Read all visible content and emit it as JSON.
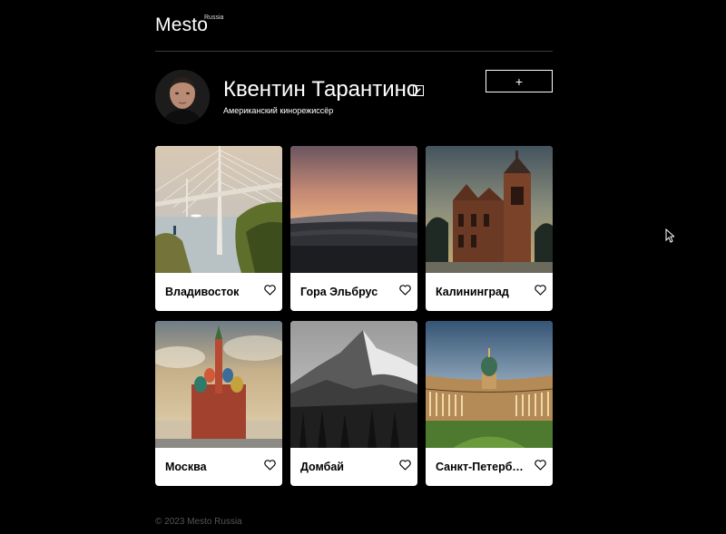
{
  "header": {
    "logo": "Mesto",
    "logo_sup": "Russia"
  },
  "profile": {
    "name": "Квентин Тарантино",
    "job": "Американский кинорежиссёр",
    "edit_icon": "pencil-icon",
    "add_label": "+"
  },
  "cards": [
    {
      "title": "Владивосток",
      "image": "bridge-photo"
    },
    {
      "title": "Гора Эльбрус",
      "image": "sunset-photo"
    },
    {
      "title": "Калининград",
      "image": "cathedral-photo"
    },
    {
      "title": "Москва",
      "image": "kremlin-photo"
    },
    {
      "title": "Домбай",
      "image": "mountain-photo"
    },
    {
      "title": "Санкт-Петербург",
      "image": "kazan-cathedral-photo"
    }
  ],
  "footer": {
    "copyright": "© 2023 Mesto Russia"
  },
  "colors": {
    "background": "#000000",
    "card": "#ffffff",
    "divider": "#3d3d3d",
    "footer_text": "#545454"
  }
}
